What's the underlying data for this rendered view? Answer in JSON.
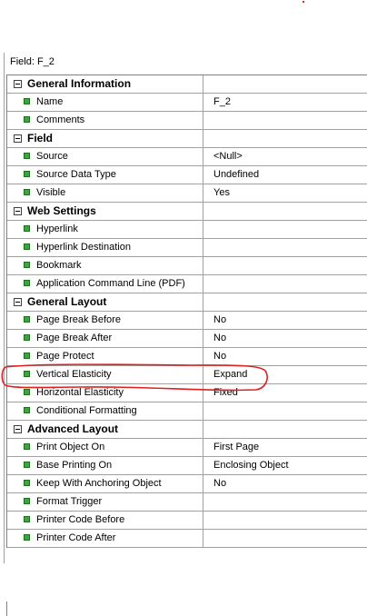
{
  "field_label": "Field: F_2",
  "categories": [
    {
      "name": "General Information",
      "properties": [
        {
          "name": "Name",
          "value": "F_2"
        },
        {
          "name": "Comments",
          "value": ""
        }
      ]
    },
    {
      "name": "Field",
      "properties": [
        {
          "name": "Source",
          "value": "<Null>"
        },
        {
          "name": "Source Data Type",
          "value": "Undefined"
        },
        {
          "name": "Visible",
          "value": "Yes"
        }
      ]
    },
    {
      "name": "Web Settings",
      "properties": [
        {
          "name": "Hyperlink",
          "value": ""
        },
        {
          "name": "Hyperlink Destination",
          "value": ""
        },
        {
          "name": "Bookmark",
          "value": ""
        },
        {
          "name": "Application Command Line (PDF)",
          "value": ""
        }
      ]
    },
    {
      "name": "General Layout",
      "properties": [
        {
          "name": "Page Break Before",
          "value": "No"
        },
        {
          "name": "Page Break After",
          "value": "No"
        },
        {
          "name": "Page Protect",
          "value": "No"
        },
        {
          "name": "Vertical Elasticity",
          "value": "Expand"
        },
        {
          "name": "Horizontal Elasticity",
          "value": "Fixed"
        },
        {
          "name": "Conditional Formatting",
          "value": ""
        }
      ]
    },
    {
      "name": "Advanced Layout",
      "properties": [
        {
          "name": "Print Object On",
          "value": "First Page"
        },
        {
          "name": "Base Printing On",
          "value": "Enclosing Object"
        },
        {
          "name": "Keep With Anchoring Object",
          "value": "No"
        },
        {
          "name": "Format Trigger",
          "value": ""
        },
        {
          "name": "Printer Code Before",
          "value": ""
        },
        {
          "name": "Printer Code After",
          "value": ""
        }
      ]
    }
  ],
  "colors": {
    "bullet": "#3aa83a",
    "annotation": "#e02020",
    "grid_line": "#a0a0a0"
  },
  "icons": {
    "category_toggle": "collapse-minus-icon",
    "property_bullet": "green-square-bullet-icon"
  }
}
